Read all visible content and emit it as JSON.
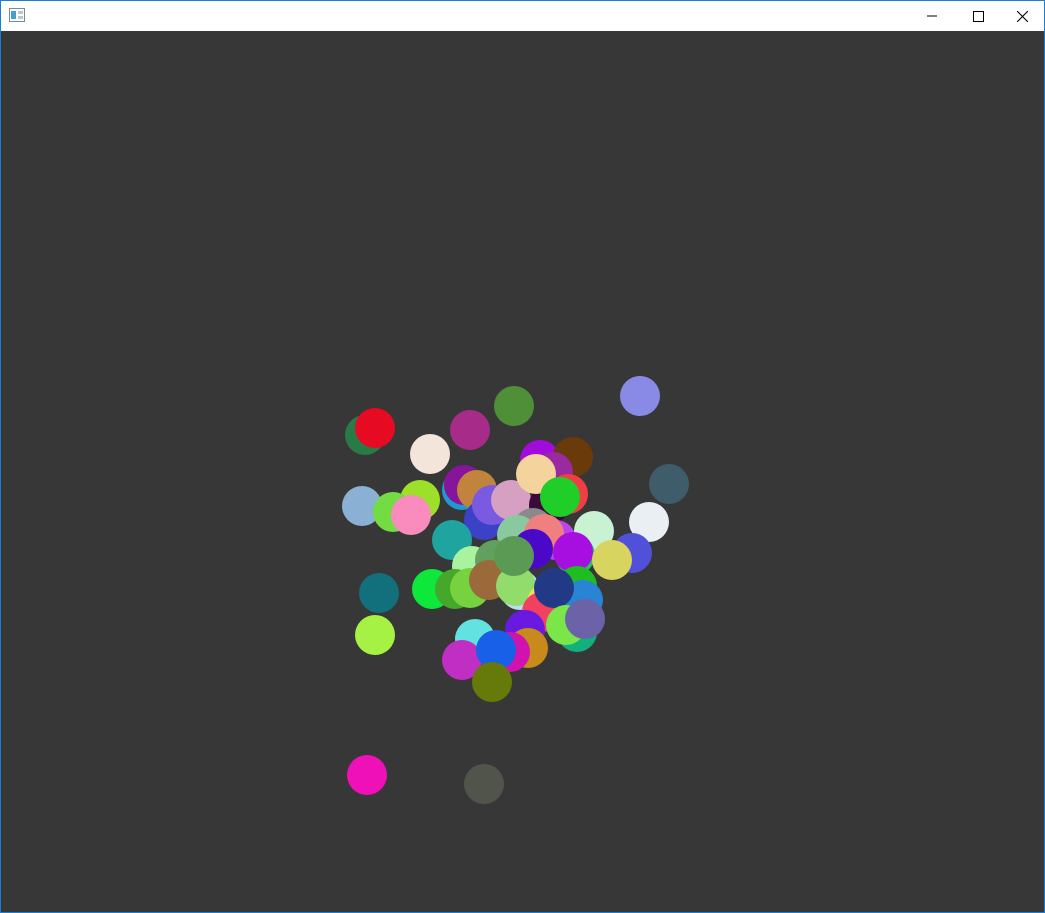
{
  "window": {
    "title": "",
    "app_icon": "window-app-icon",
    "controls": [
      {
        "name": "minimize-button",
        "icon": "minimize-icon"
      },
      {
        "name": "maximize-button",
        "icon": "maximize-icon"
      },
      {
        "name": "close-button",
        "icon": "close-icon"
      }
    ]
  },
  "scene": {
    "background": "#373737",
    "balls": [
      {
        "color": "#888ae6"
      },
      {
        "color": "#4f8f38"
      },
      {
        "color": "#2a7a47"
      },
      {
        "color": "#e60a22"
      },
      {
        "color": "#a72c8a"
      },
      {
        "color": "#f3e5d9"
      },
      {
        "color": "#3e5c69"
      },
      {
        "color": "#8ab0d4"
      },
      {
        "color": "#9ce02a"
      },
      {
        "color": "#72dc42"
      },
      {
        "color": "#f98cbc"
      },
      {
        "color": "#a10cda"
      },
      {
        "color": "#6b3a0a"
      },
      {
        "color": "#9a2aa0"
      },
      {
        "color": "#f23d45"
      },
      {
        "color": "#1f9ad0"
      },
      {
        "color": "#86159c"
      },
      {
        "color": "#c2843d"
      },
      {
        "color": "#3b42c8"
      },
      {
        "color": "#7a5ae0"
      },
      {
        "color": "#d6a0c2"
      },
      {
        "color": "#3a0a3a"
      },
      {
        "color": "#f5d39c"
      },
      {
        "color": "#20ce2a"
      },
      {
        "color": "#e9eff2"
      },
      {
        "color": "#20a4a0"
      },
      {
        "color": "#c8f2d2"
      },
      {
        "color": "#5050d8"
      },
      {
        "color": "#2cc060"
      },
      {
        "color": "#b845ee"
      },
      {
        "color": "#8a8a8a"
      },
      {
        "color": "#8ac9a0"
      },
      {
        "color": "#f08080"
      },
      {
        "color": "#a70ee0"
      },
      {
        "color": "#a8f2a0"
      },
      {
        "color": "#4a08c8"
      },
      {
        "color": "#d8d460"
      },
      {
        "color": "#63a060"
      },
      {
        "color": "#12707c"
      },
      {
        "color": "#0ee83a"
      },
      {
        "color": "#46a82a"
      },
      {
        "color": "#76d23e"
      },
      {
        "color": "#9a6a3a"
      },
      {
        "color": "#bcdcf2"
      },
      {
        "color": "#92dc6c"
      },
      {
        "color": "#1ebe20"
      },
      {
        "color": "#f0e060"
      },
      {
        "color": "#f24060"
      },
      {
        "color": "#2a84d4"
      },
      {
        "color": "#223a86"
      },
      {
        "color": "#a6f244"
      },
      {
        "color": "#6a1ae0"
      },
      {
        "color": "#12b07c"
      },
      {
        "color": "#7ae64a"
      },
      {
        "color": "#6c62a8"
      },
      {
        "color": "#62e2e0"
      },
      {
        "color": "#c02ec4"
      },
      {
        "color": "#c88a1a"
      },
      {
        "color": "#d012b0"
      },
      {
        "color": "#1860e8"
      },
      {
        "color": "#667a0a"
      },
      {
        "color": "#f010b8"
      },
      {
        "color": "#50544a"
      },
      {
        "color": "#5a9a54"
      }
    ]
  }
}
